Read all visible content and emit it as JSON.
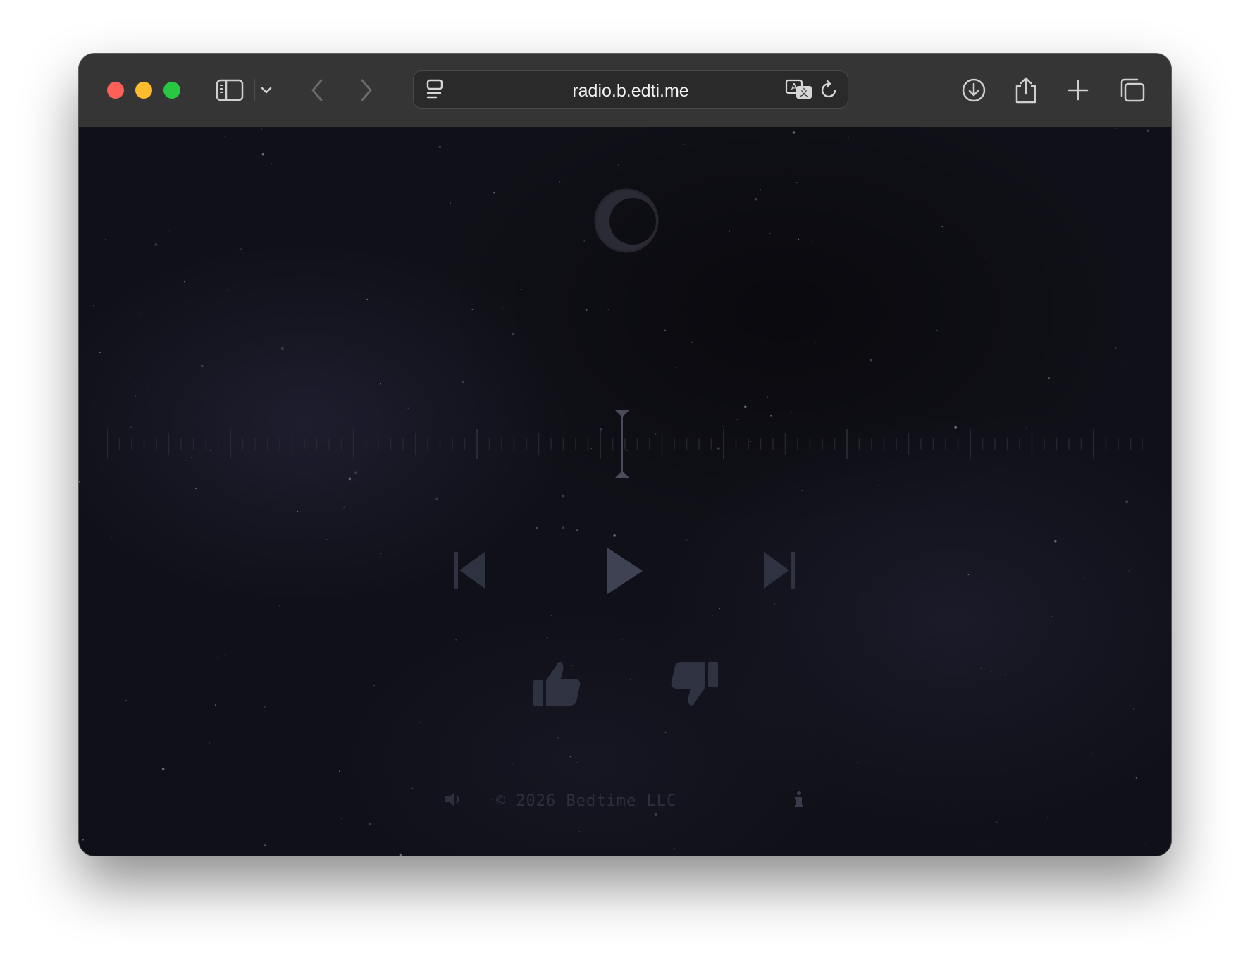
{
  "browser": {
    "url": "radio.b.edti.me",
    "icons": [
      "sidebar-icon",
      "chevron-down-icon",
      "back-icon",
      "forward-icon",
      "page-menu-icon",
      "translate-icon",
      "reload-icon",
      "download-icon",
      "share-icon",
      "new-tab-icon",
      "tabs-overview-icon"
    ]
  },
  "player": {
    "logo_icon": "crescent-moon-icon",
    "controls": [
      "skip-back-icon",
      "play-icon",
      "skip-forward-icon"
    ],
    "feedback": [
      "thumbs-up-icon",
      "thumbs-down-icon"
    ],
    "accent_color": "#3e4252"
  },
  "footer": {
    "copyright": "© 2026 Bedtime LLC",
    "volume_icon": "volume-icon",
    "info_icon": "info-icon"
  }
}
